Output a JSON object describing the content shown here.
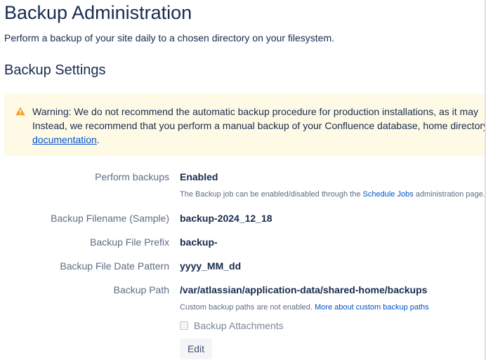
{
  "page": {
    "title": "Backup Administration",
    "subtitle": "Perform a backup of your site daily to a chosen directory on your filesystem."
  },
  "section": {
    "title": "Backup Settings"
  },
  "warning": {
    "icon": "warning-icon",
    "color": "#ff991f",
    "line1": "Warning: We do not recommend the automatic backup procedure for production installations, as it may",
    "line2": "Instead, we recommend that you perform a manual backup of your Confluence database, home directory",
    "link_text": "documentation",
    "after_link": "."
  },
  "settings": {
    "perform_backups": {
      "label": "Perform backups",
      "value": "Enabled",
      "help_prefix": "The Backup job can be enabled/disabled through the ",
      "help_link": "Schedule Jobs",
      "help_suffix": " administration page."
    },
    "filename_sample": {
      "label": "Backup Filename (Sample)",
      "value": "backup-2024_12_18"
    },
    "file_prefix": {
      "label": "Backup File Prefix",
      "value": "backup-"
    },
    "date_pattern": {
      "label": "Backup File Date Pattern",
      "value": "yyyy_MM_dd"
    },
    "backup_path": {
      "label": "Backup Path",
      "value": "/var/atlassian/application-data/shared-home/backups",
      "help_prefix": "Custom backup paths are not enabled. ",
      "help_link": "More about custom backup paths"
    },
    "attachments": {
      "label": "Backup Attachments",
      "checked": false,
      "disabled": true
    }
  },
  "actions": {
    "edit_label": "Edit"
  },
  "colors": {
    "text": "#172b4d",
    "label": "#5e6c84",
    "link": "#0052cc",
    "warning_bg": "#fffae6"
  }
}
